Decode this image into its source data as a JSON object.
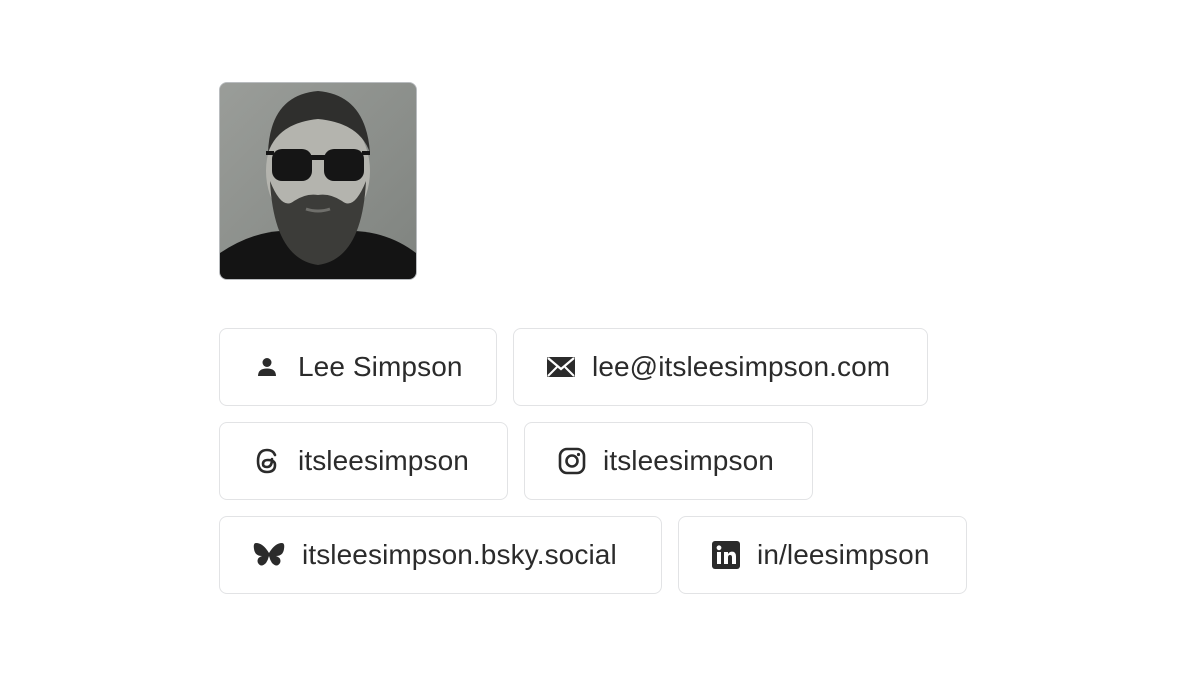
{
  "profile": {
    "avatar_alt": "Lee Simpson"
  },
  "links": [
    {
      "label": "Lee Simpson",
      "icon": "person-icon"
    },
    {
      "label": "lee@itsleesimpson.com",
      "icon": "mail-icon"
    },
    {
      "label": "itsleesimpson",
      "icon": "threads-icon"
    },
    {
      "label": "itsleesimpson",
      "icon": "instagram-icon"
    },
    {
      "label": "itsleesimpson.bsky.social",
      "icon": "bluesky-butterfly-icon"
    },
    {
      "label": "in/leesimpson",
      "icon": "linkedin-icon"
    }
  ],
  "colors": {
    "text": "#2b2b2b",
    "chip_border": "#e2e3e5",
    "avatar_border": "#b9bcbf"
  }
}
